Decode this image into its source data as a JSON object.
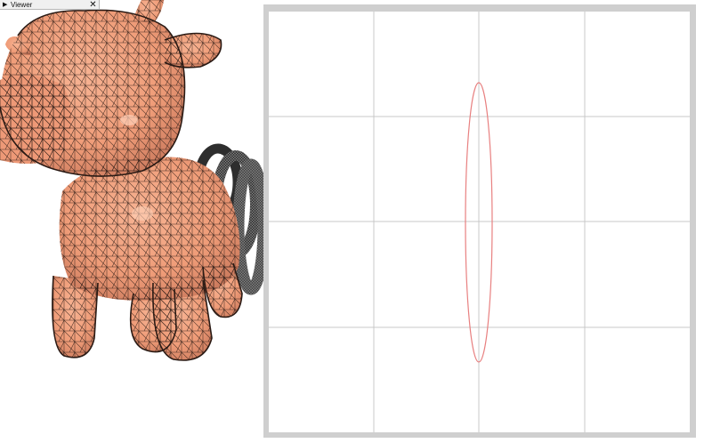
{
  "viewer_panel": {
    "title": "Viewer",
    "toggle_icon": "triangle-right-icon",
    "close_icon": "close-icon"
  },
  "scene3d": {
    "objects": [
      "cow-mesh",
      "torus-knot-mesh"
    ],
    "mesh_color": "#f2a07e",
    "wire_color": "#2a1a14",
    "coil_color": "#3a3a3a"
  },
  "plot2d": {
    "curve_color": "#e88080",
    "grid_color": "#c8c8c8",
    "background": "#ffffff"
  }
}
